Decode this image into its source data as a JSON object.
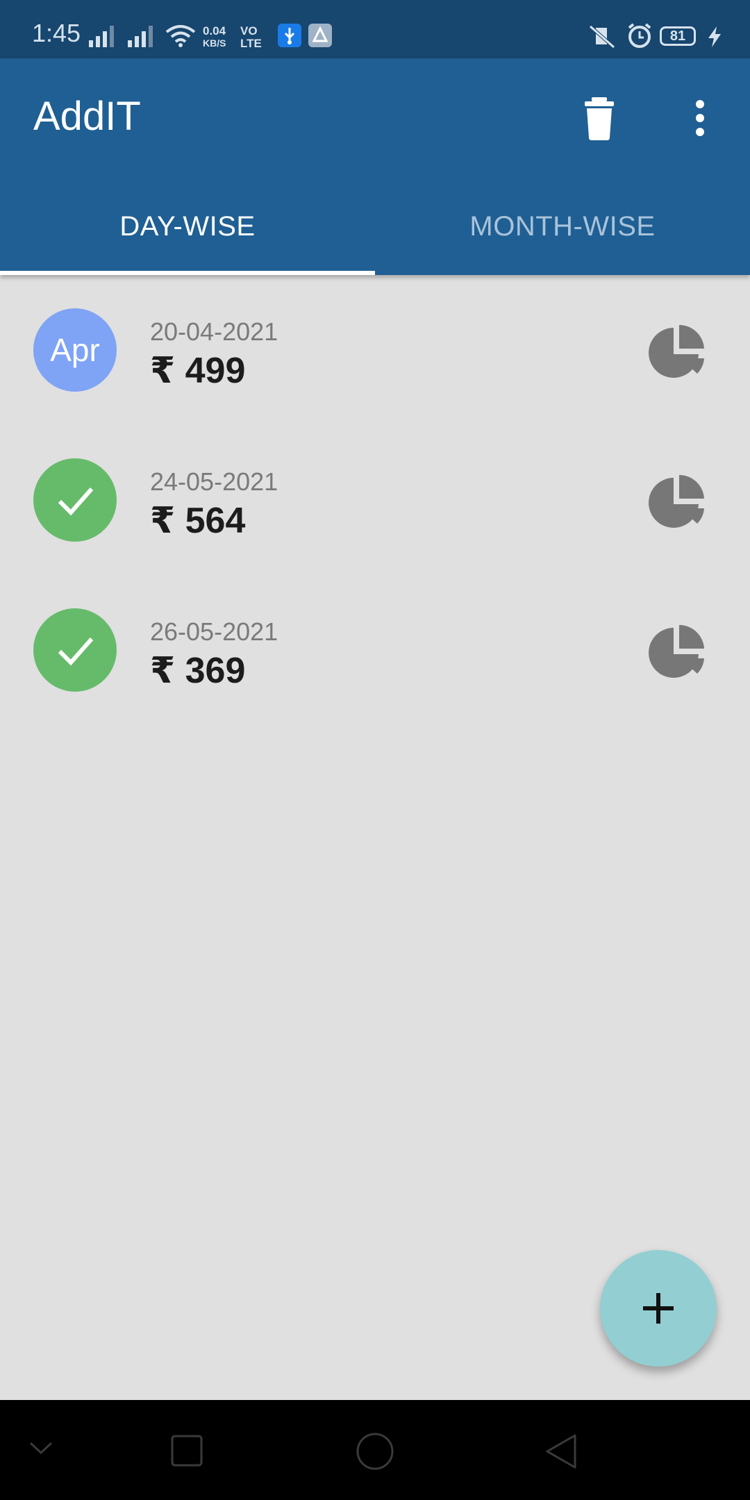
{
  "status_bar": {
    "time": "1:45",
    "net_speed_value": "0.04",
    "net_speed_unit": "KB/S",
    "volte_top": "VO",
    "volte_bottom": "LTE",
    "battery": "81",
    "icons": [
      "signal-icon",
      "signal-icon",
      "wifi-icon",
      "usb-icon",
      "app-notification-icon",
      "vibrate-off-icon",
      "alarm-icon",
      "battery-icon",
      "charging-icon"
    ]
  },
  "app_bar": {
    "title": "AddIT",
    "actions": [
      "delete-icon",
      "more-vert-icon"
    ],
    "color": "#1f5f93"
  },
  "tabs": [
    {
      "label": "DAY-WISE",
      "selected": true
    },
    {
      "label": "MONTH-WISE",
      "selected": false
    }
  ],
  "entries": [
    {
      "avatar_text": "Apr",
      "avatar_color": "#7fa3f5",
      "date": "20-04-2021",
      "amount": "₹ 499",
      "icon": "pie-chart-icon"
    },
    {
      "avatar_icon": "check-icon",
      "avatar_color": "#66bb6a",
      "date": "24-05-2021",
      "amount": "₹ 564",
      "icon": "pie-chart-icon"
    },
    {
      "avatar_icon": "check-icon",
      "avatar_color": "#66bb6a",
      "date": "26-05-2021",
      "amount": "₹ 369",
      "icon": "pie-chart-icon"
    }
  ],
  "fab": {
    "icon": "add-icon",
    "color": "#93ced2"
  },
  "nav_bar": {
    "icons": [
      "chevron-down-icon",
      "recents-icon",
      "home-icon",
      "back-icon"
    ]
  }
}
